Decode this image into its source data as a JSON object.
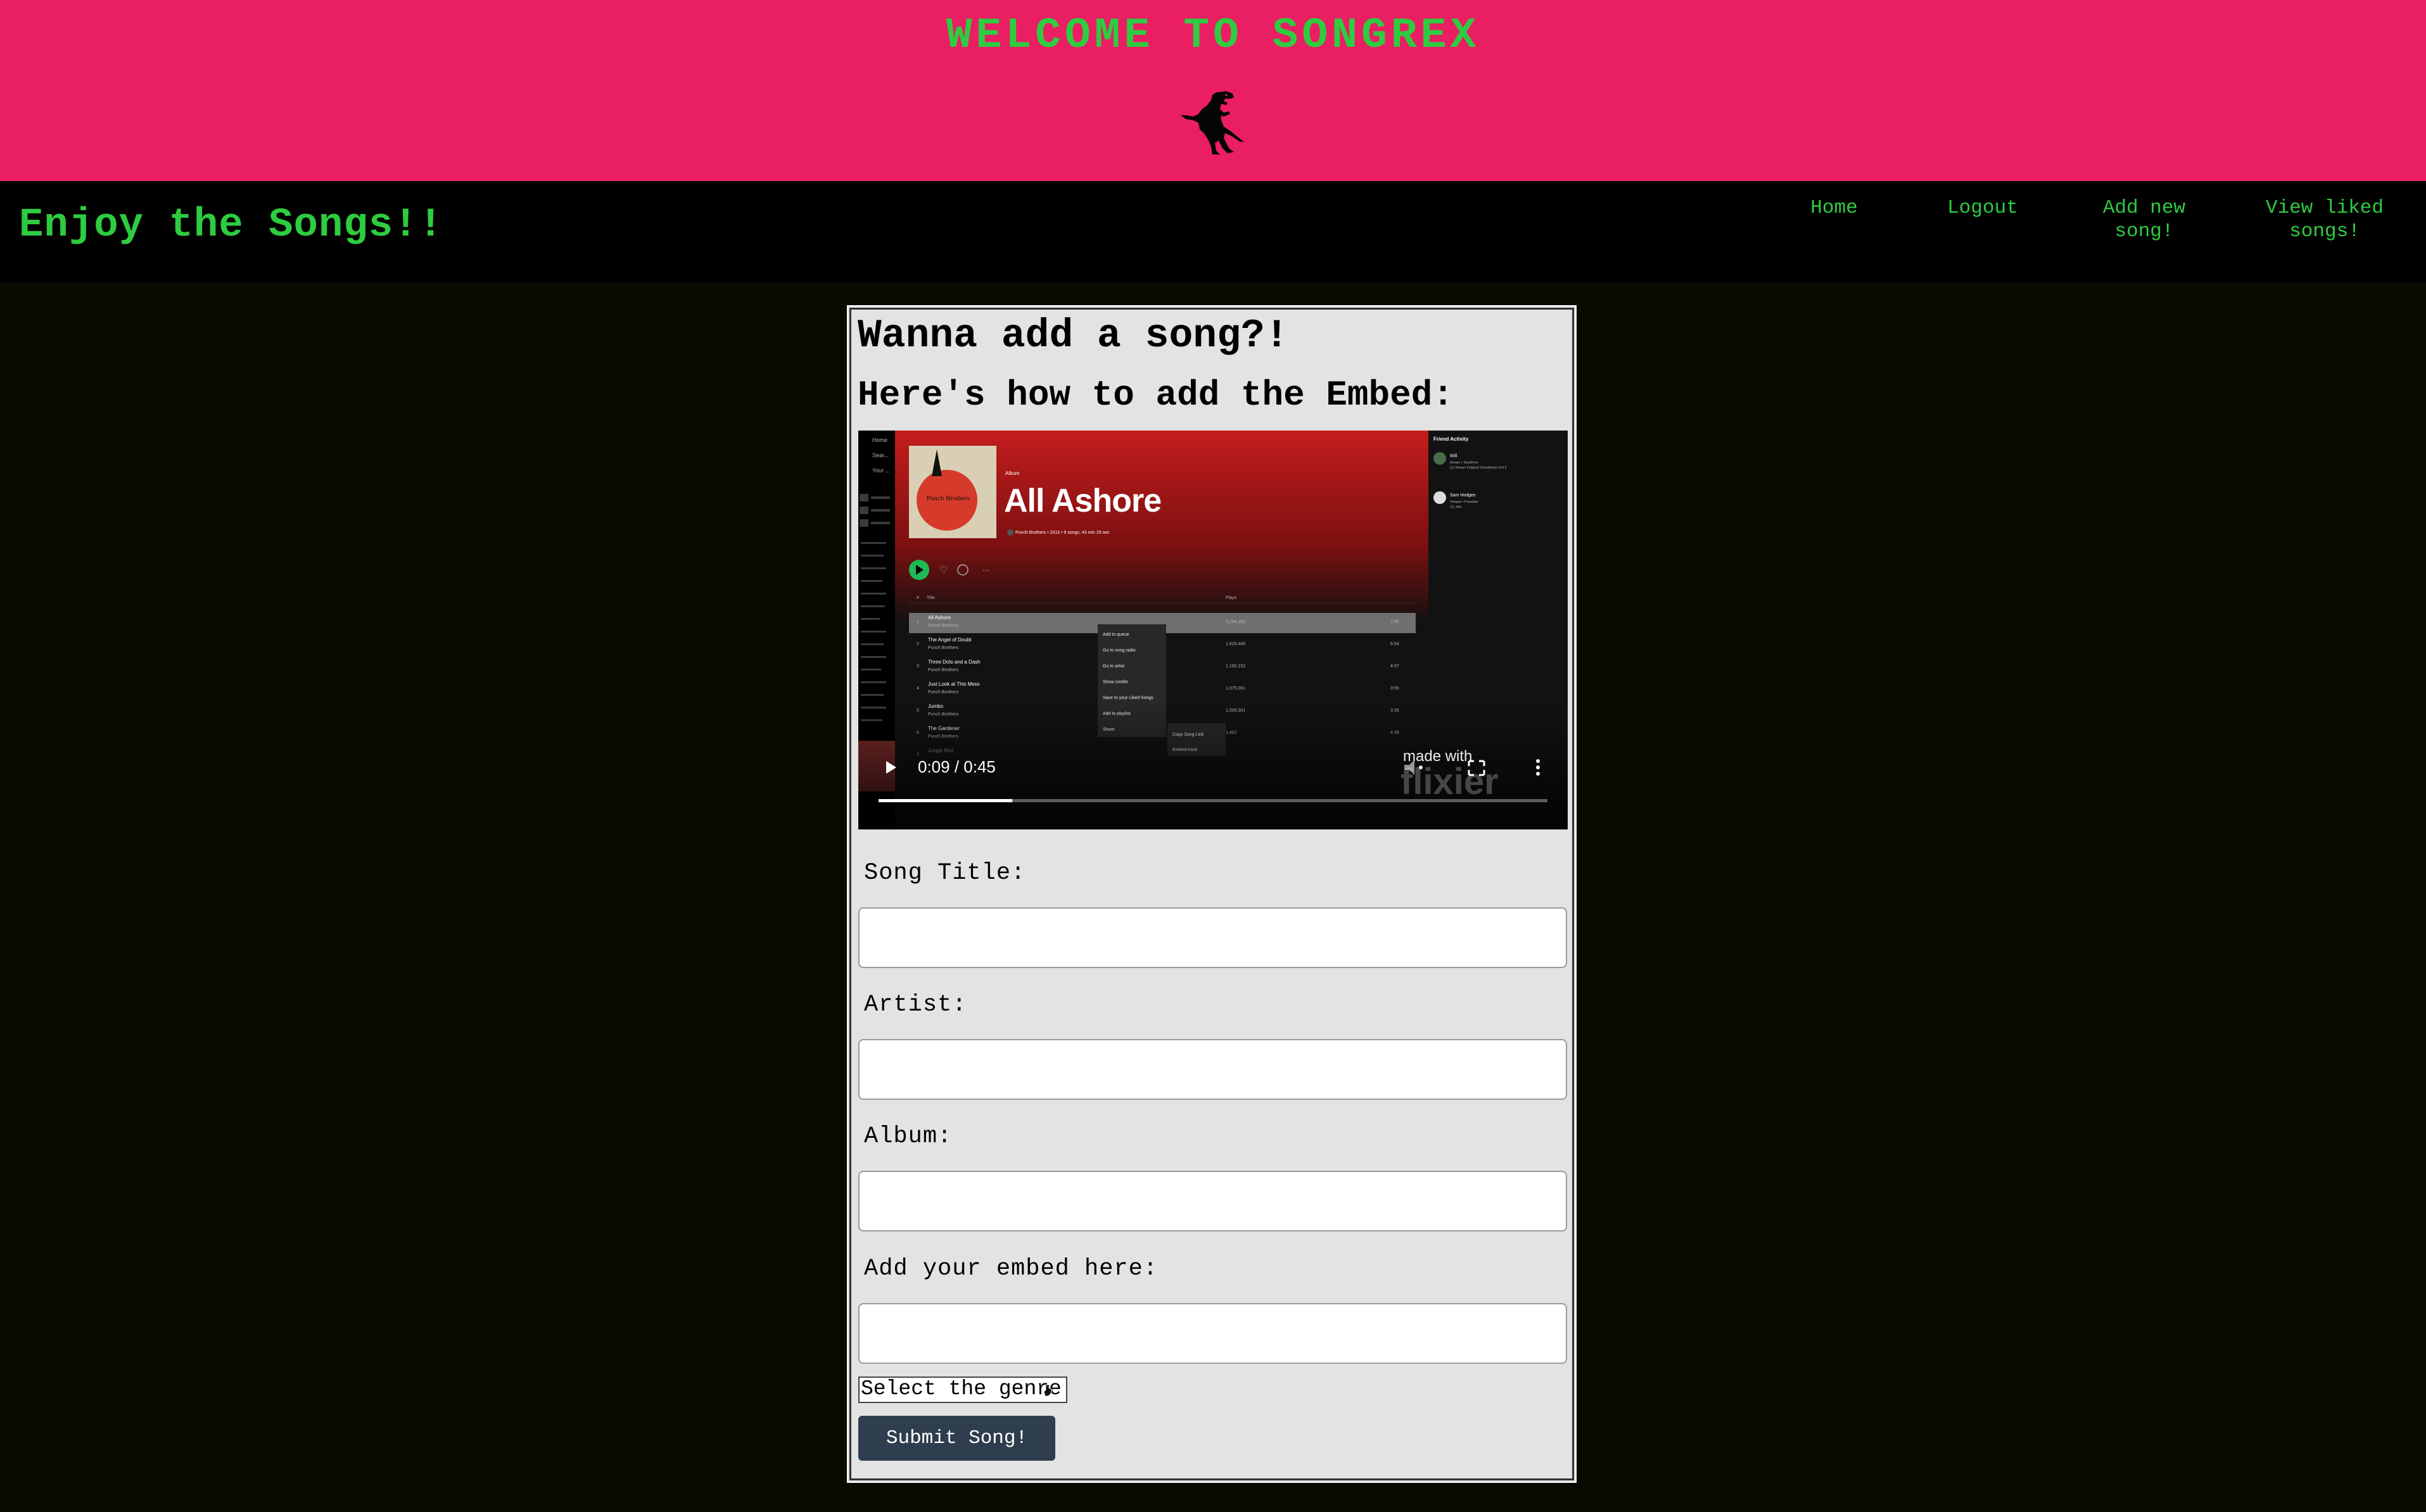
{
  "header": {
    "title": "WELCOME TO SONGREX",
    "logo_icon": "t-rex-icon"
  },
  "navbar": {
    "tagline": "Enjoy the Songs!!",
    "links": [
      {
        "line1": "Home",
        "line2": ""
      },
      {
        "line1": "Logout",
        "line2": ""
      },
      {
        "line1": "Add new",
        "line2": "song!"
      },
      {
        "line1": "View liked",
        "line2": "songs!"
      }
    ]
  },
  "form": {
    "heading": "Wanna add a song?!",
    "subheading": "Here's how to add the Embed:",
    "labels": {
      "title": "Song Title:",
      "artist": "Artist:",
      "album": "Album:",
      "embed": "Add your embed here:"
    },
    "values": {
      "title": "",
      "artist": "",
      "album": "",
      "embed": ""
    },
    "genre_select": "Select the genre!",
    "submit_label": "Submit Song!"
  },
  "video": {
    "album_type": "Album",
    "album_title": "All Ashore",
    "album_meta": "Punch Brothers • 2015 • 9 songs, 43 min 29 sec",
    "cover_text": "Punch Brothers",
    "col_title": "Title",
    "col_plays": "Plays",
    "tracks": [
      {
        "n": "1",
        "title": "All Ashore",
        "artist": "Punch Brothers",
        "plays": "3,294,395",
        "dur": "7:45"
      },
      {
        "n": "2",
        "title": "The Angel of Doubt",
        "artist": "Punch Brothers",
        "plays": "1,620,440",
        "dur": "6:54"
      },
      {
        "n": "3",
        "title": "Three Dots and a Dash",
        "artist": "Punch Brothers",
        "plays": "1,160,152",
        "dur": "4:07"
      },
      {
        "n": "4",
        "title": "Just Look at This Mess",
        "artist": "Punch Brothers",
        "plays": "1,075,061",
        "dur": "3:55"
      },
      {
        "n": "5",
        "title": "Jumbo",
        "artist": "Punch Brothers",
        "plays": "1,009,301",
        "dur": "3:35"
      },
      {
        "n": "6",
        "title": "The Gardener",
        "artist": "Punch Brothers",
        "plays": "1,452",
        "dur": "4:39"
      },
      {
        "n": "7",
        "title": "Jungle Bird",
        "artist": "",
        "plays": "",
        "dur": ""
      }
    ],
    "context_menu": [
      "Add to queue",
      "Go to song radio",
      "Go to artist",
      "Show credits",
      "Save to your Liked Songs",
      "Add to playlist",
      "Share"
    ],
    "share_menu": [
      "Copy Song Link",
      "Embed track"
    ],
    "friend_activity_title": "Friend Activity",
    "friends": [
      {
        "name": "Will",
        "line1": "Dream • SoulFires",
        "line2": "(1) Shawn Original Soundtrack Ost 2"
      },
      {
        "name": "Sam Hodges",
        "line1": "Tongue • Paradise",
        "line2": "(1) Jam"
      }
    ],
    "sidebar_items": [
      "Home",
      "Sear...",
      "Your ..."
    ],
    "time": "0:09 / 0:45",
    "progress": 0.2,
    "watermark_top": "made with",
    "watermark_bottom": "flixier"
  }
}
